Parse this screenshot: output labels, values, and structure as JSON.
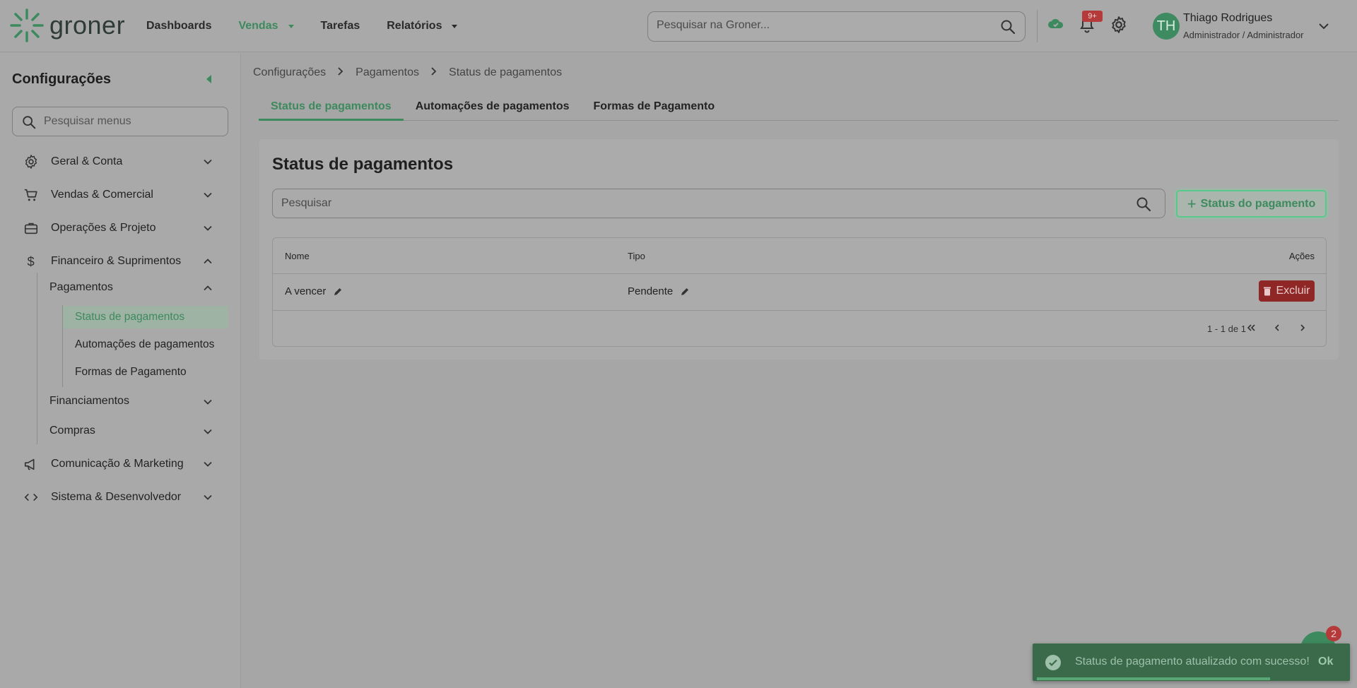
{
  "app": {
    "logo_text": "groner"
  },
  "nav": {
    "dashboards": "Dashboards",
    "vendas": "Vendas",
    "tarefas": "Tarefas",
    "relatorios": "Relatórios"
  },
  "global_search": {
    "placeholder": "Pesquisar na Groner..."
  },
  "notifications": {
    "badge": "9+"
  },
  "user": {
    "initials": "TH",
    "name": "Thiago Rodrigues",
    "role": "Administrador / Administrador"
  },
  "sidebar": {
    "title": "Configurações",
    "search_placeholder": "Pesquisar menus",
    "items": [
      {
        "label": "Geral & Conta",
        "icon": "gear-icon"
      },
      {
        "label": "Vendas & Comercial",
        "icon": "cart-icon"
      },
      {
        "label": "Operações & Projeto",
        "icon": "briefcase-icon"
      },
      {
        "label": "Financeiro & Suprimentos",
        "icon": "dollar-icon"
      },
      {
        "label": "Comunicação & Marketing",
        "icon": "megaphone-icon"
      },
      {
        "label": "Sistema & Desenvolvedor",
        "icon": "code-icon"
      }
    ],
    "sub": {
      "pagamentos": "Pagamentos",
      "leaves": [
        "Status de pagamentos",
        "Automações de pagamentos",
        "Formas de Pagamento"
      ],
      "financiamentos": "Financiamentos",
      "compras": "Compras"
    }
  },
  "breadcrumb": [
    "Configurações",
    "Pagamentos",
    "Status de pagamentos"
  ],
  "tabs": [
    "Status de pagamentos",
    "Automações de pagamentos",
    "Formas de Pagamento"
  ],
  "panel": {
    "title": "Status de pagamentos",
    "search_placeholder": "Pesquisar",
    "add_button": "Status do pagamento"
  },
  "table": {
    "headers": {
      "nome": "Nome",
      "tipo": "Tipo",
      "acoes": "Ações"
    },
    "rows": [
      {
        "nome": "A vencer",
        "tipo": "Pendente",
        "action": "Excluir"
      }
    ],
    "pagination": "1 - 1 de 1"
  },
  "toast": {
    "message": "Status de pagamento atualizado com sucesso!",
    "ok": "Ok"
  },
  "chat": {
    "badge": "2"
  },
  "colors": {
    "accent": "#3d8a5e",
    "danger": "#8f2727",
    "toast": "#3a6a4a"
  }
}
